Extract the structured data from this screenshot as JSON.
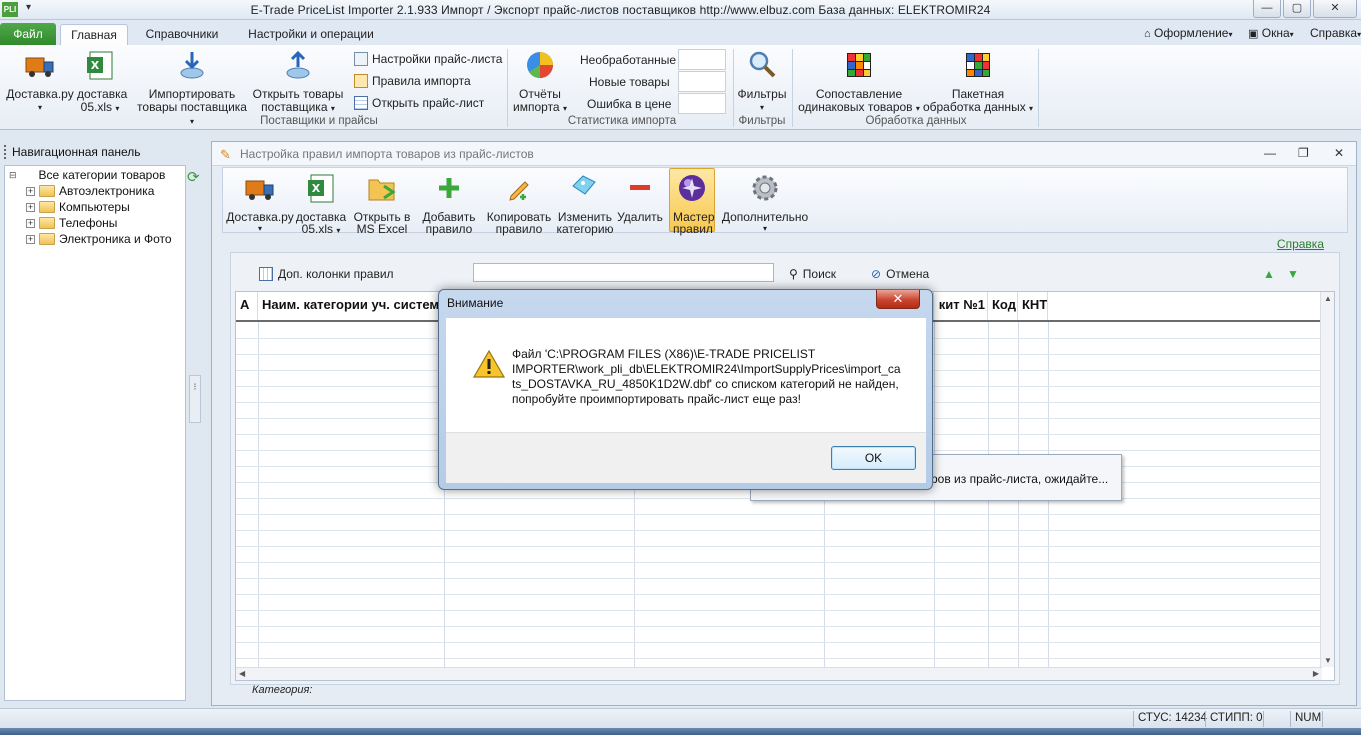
{
  "window": {
    "app_icon_text": "PLI",
    "title": "E-Trade PriceList Importer 2.1.933     Импорт / Экспорт прайс-листов поставщиков     http://www.elbuz.com     База данных: ELEKTROMIR24",
    "min": "—",
    "max": "▢",
    "close": "✕"
  },
  "ribbon_tabs": {
    "file": "Файл",
    "tabs": [
      "Главная",
      "Справочники",
      "Настройки и операции"
    ],
    "right": [
      "Оформление",
      "Окна",
      "Справка"
    ]
  },
  "ribbon": {
    "delivery_label": "Доставка.ру",
    "delivery_xls_l1": "доставка",
    "delivery_xls_l2": "05.xls",
    "import_l1": "Импортировать",
    "import_l2": "товары поставщика",
    "open_goods_l1": "Открыть товары",
    "open_goods_l2": "поставщика",
    "group_suppliers": "Поставщики и прайсы",
    "settings_pl": "Настройки прайс-листа",
    "import_rules": "Правила импорта",
    "open_pl": "Открыть прайс-лист",
    "reports_l1": "Отчёты",
    "reports_l2": "импорта",
    "stat_unprocessed": "Необработанные",
    "stat_new": "Новые товары",
    "stat_price_err": "Ошибка в цене",
    "group_stats": "Статистика импорта",
    "filters": "Фильтры",
    "group_filters": "Фильтры",
    "match_l1": "Сопоставление",
    "match_l2": "одинаковых товаров",
    "batch_l1": "Пакетная",
    "batch_l2": "обработка данных",
    "group_data": "Обработка данных"
  },
  "nav": {
    "header": "Навигационная панель",
    "root": "Все категории товаров",
    "items": [
      "Автоэлектроника",
      "Компьютеры",
      "Телефоны",
      "Электроника и Фото"
    ]
  },
  "inner": {
    "title": "Настройка правил импорта товаров из прайс-листов",
    "toolbar": {
      "delivery": "Доставка.ру",
      "delivery_xls_l1": "доставка",
      "delivery_xls_l2": "05.xls",
      "open_excel_l1": "Открыть в",
      "open_excel_l2": "MS Excel",
      "add_l1": "Добавить",
      "add_l2": "правило",
      "copy_l1": "Копировать",
      "copy_l2": "правило",
      "change_l1": "Изменить",
      "change_l2": "категорию",
      "delete": "Удалить",
      "wizard_l1": "Мастер",
      "wizard_l2": "правил",
      "extra": "Дополнительно"
    },
    "help": "Справка",
    "extra_cols": "Доп. колонки правил",
    "search_value": "",
    "search": "Поиск",
    "cancel": "Отмена",
    "columns": [
      "А",
      "Наим. категории уч. системы",
      "",
      "",
      "",
      "кит №1",
      "Код",
      "КНТ"
    ],
    "category_label": "Категория:"
  },
  "progress": {
    "text": "ров из прайс-листа, ожидайте..."
  },
  "dialog": {
    "title": "Внимание",
    "close": "✕",
    "message": "Файл 'C:\\PROGRAM FILES (X86)\\E-TRADE PRICELIST\nIMPORTER\\work_pli_db\\ELEKTROMIR24\\ImportSupplyPrices\\import_ca\nts_DOSTAVKA_RU_4850K1D2W.dbf' со списком категорий не найден,\nпопробуйте проимпортировать прайс-лист еще раз!",
    "ok": "OK"
  },
  "status": {
    "stus": "СТУС: 14234",
    "stipp": "СТИПП: 0",
    "num": "NUM"
  },
  "colors": {
    "accent_green": "#2f8a2b",
    "dialog_frame": "#b4cbe6",
    "wizard_highlight": "#f8c84e"
  }
}
